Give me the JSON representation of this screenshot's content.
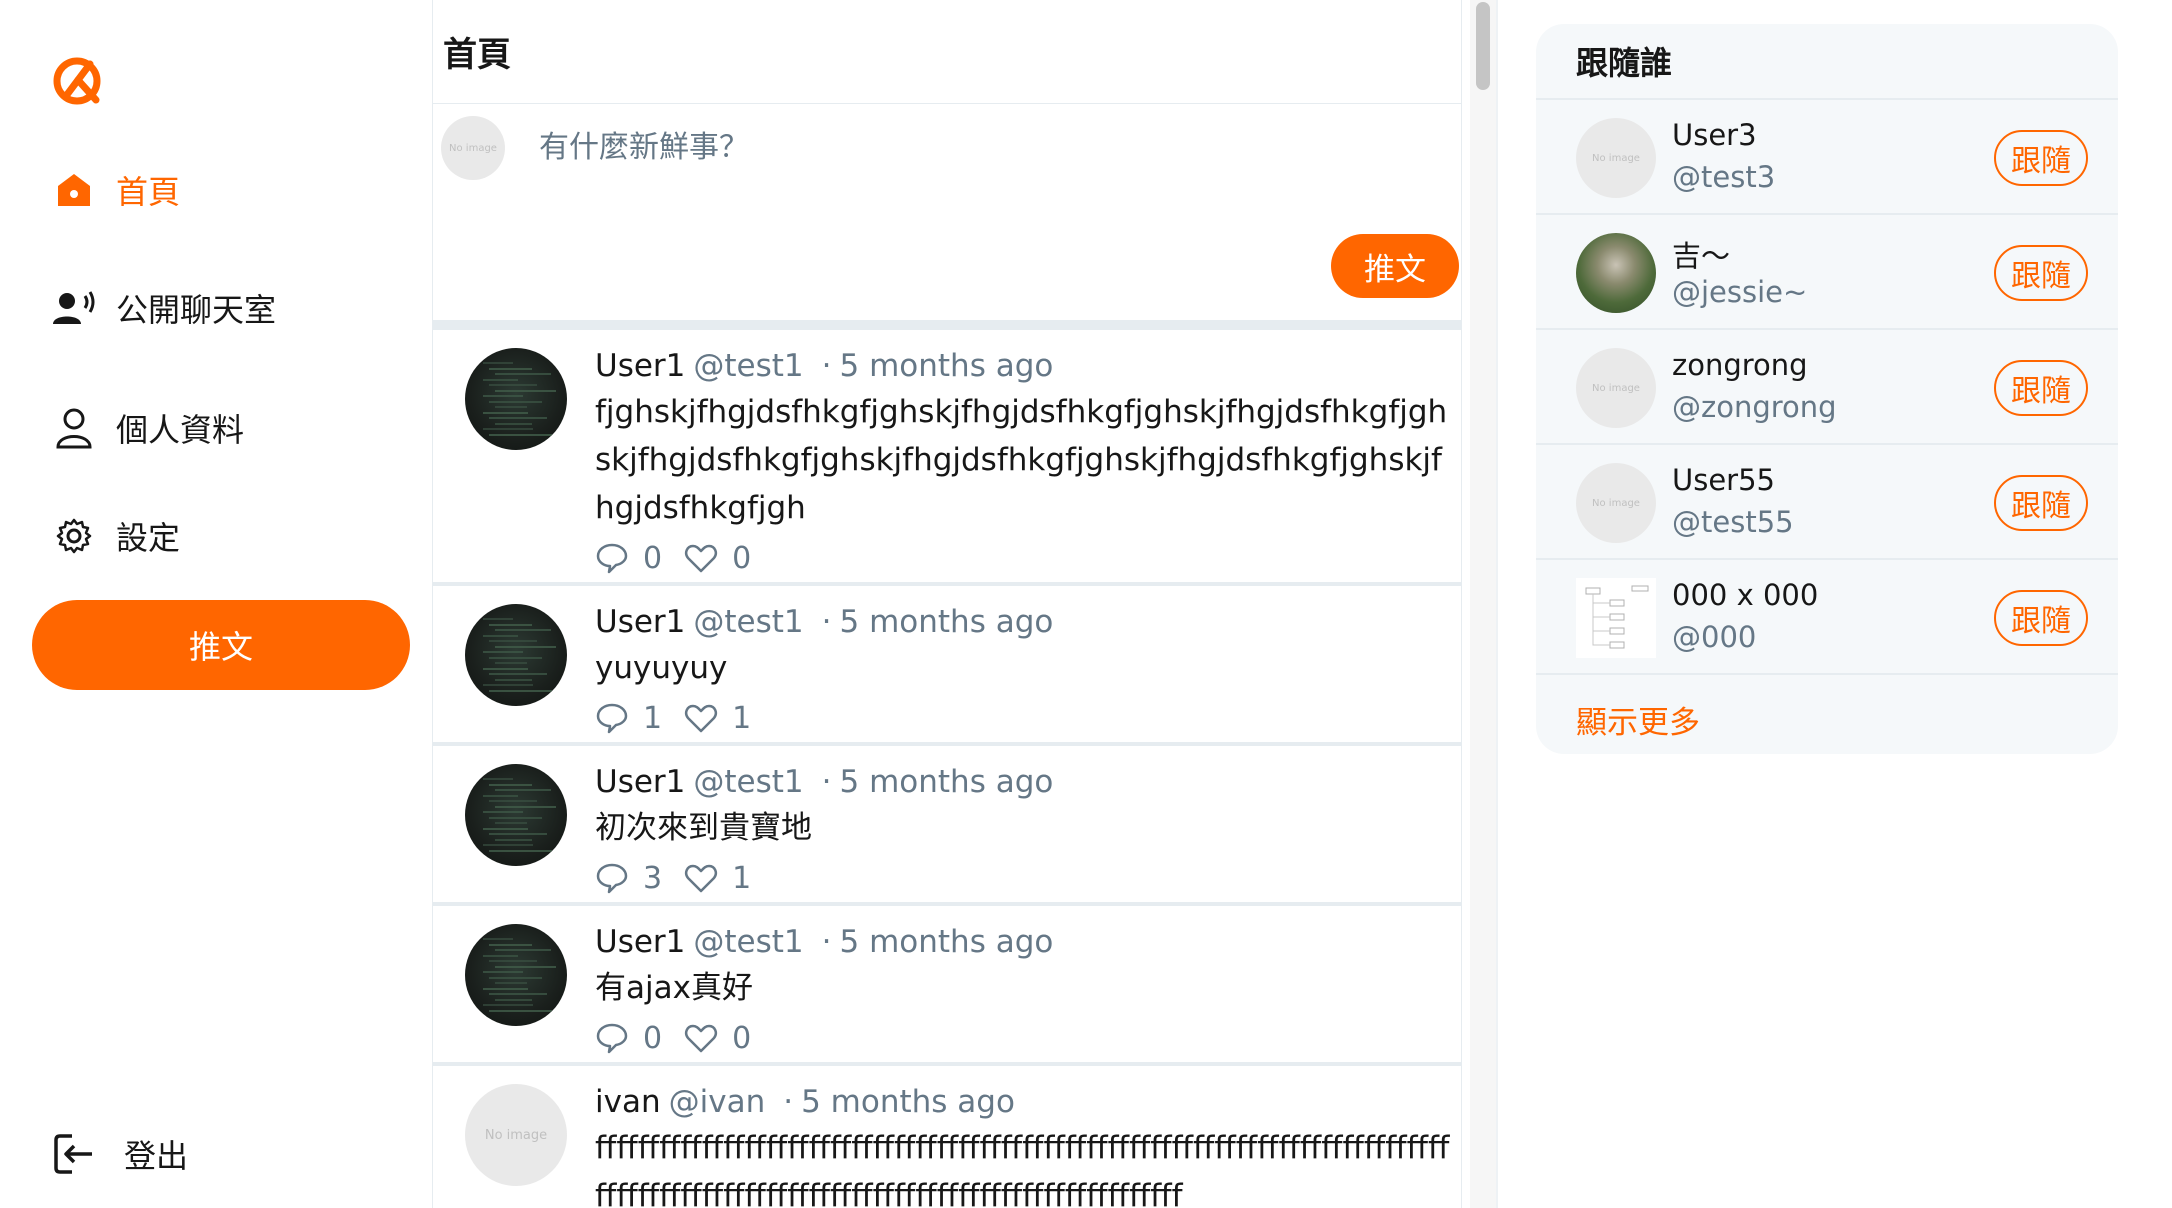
{
  "sidebar": {
    "nav": [
      {
        "label": "首頁",
        "icon": "home-icon"
      },
      {
        "label": "公開聊天室",
        "icon": "chat-users-icon"
      },
      {
        "label": "個人資料",
        "icon": "user-icon"
      },
      {
        "label": "設定",
        "icon": "gear-icon"
      }
    ],
    "tweet_button": "推文",
    "logout_label": "登出"
  },
  "main": {
    "title": "首頁",
    "composer": {
      "avatar_text": "No image",
      "placeholder": "有什麼新鮮事？",
      "tweet_button": "推文"
    },
    "tweets": [
      {
        "name": "User1",
        "handle": "@test1",
        "dot": "·",
        "time": "5 months ago",
        "content": "fjghskjfhgjdsfhkgfjghskjfhgjdsfhkgfjghskjfhgjdsfhkgfjghskjfhgjdsfhkgfjghskjfhgjdsfhkgfjghskjfhgjdsfhkgfjghskjfhgjdsfhkgfjgh",
        "replies": "0",
        "likes": "0"
      },
      {
        "name": "User1",
        "handle": "@test1",
        "dot": "·",
        "time": "5 months ago",
        "content": "yuyuyuy",
        "replies": "1",
        "likes": "1"
      },
      {
        "name": "User1",
        "handle": "@test1",
        "dot": "·",
        "time": "5 months ago",
        "content": "初次來到貴寶地",
        "replies": "3",
        "likes": "1"
      },
      {
        "name": "User1",
        "handle": "@test1",
        "dot": "·",
        "time": "5 months ago",
        "content": "有ajax真好",
        "replies": "0",
        "likes": "0"
      },
      {
        "name": "ivan",
        "handle": "@ivan",
        "dot": "·",
        "time": "5 months ago",
        "content": "fffffffffffffffffffffffffffffffffffffffffffffffffffffffffffffffffffffffffffffffffffffffffffffffffffffffffffffffffffffffffffffffffffffff",
        "avatar_text": "No image",
        "replies": "",
        "likes": ""
      }
    ]
  },
  "who_to_follow": {
    "title": "跟隨誰",
    "users": [
      {
        "name": "User3",
        "handle": "@test3",
        "avatar_text": "No image",
        "button": "跟隨"
      },
      {
        "name": "吉～",
        "handle": "@jessie~",
        "button": "跟隨"
      },
      {
        "name": "zongrong",
        "handle": "@zongrong",
        "avatar_text": "No image",
        "button": "跟隨"
      },
      {
        "name": "User55",
        "handle": "@test55",
        "avatar_text": "No image",
        "button": "跟隨"
      },
      {
        "name": "000 x 000",
        "handle": "@000",
        "button": "跟隨"
      }
    ],
    "show_more": "顯示更多"
  },
  "colors": {
    "accent": "#ff6600",
    "muted": "#657786",
    "panel_bg": "#f5f8fa"
  }
}
